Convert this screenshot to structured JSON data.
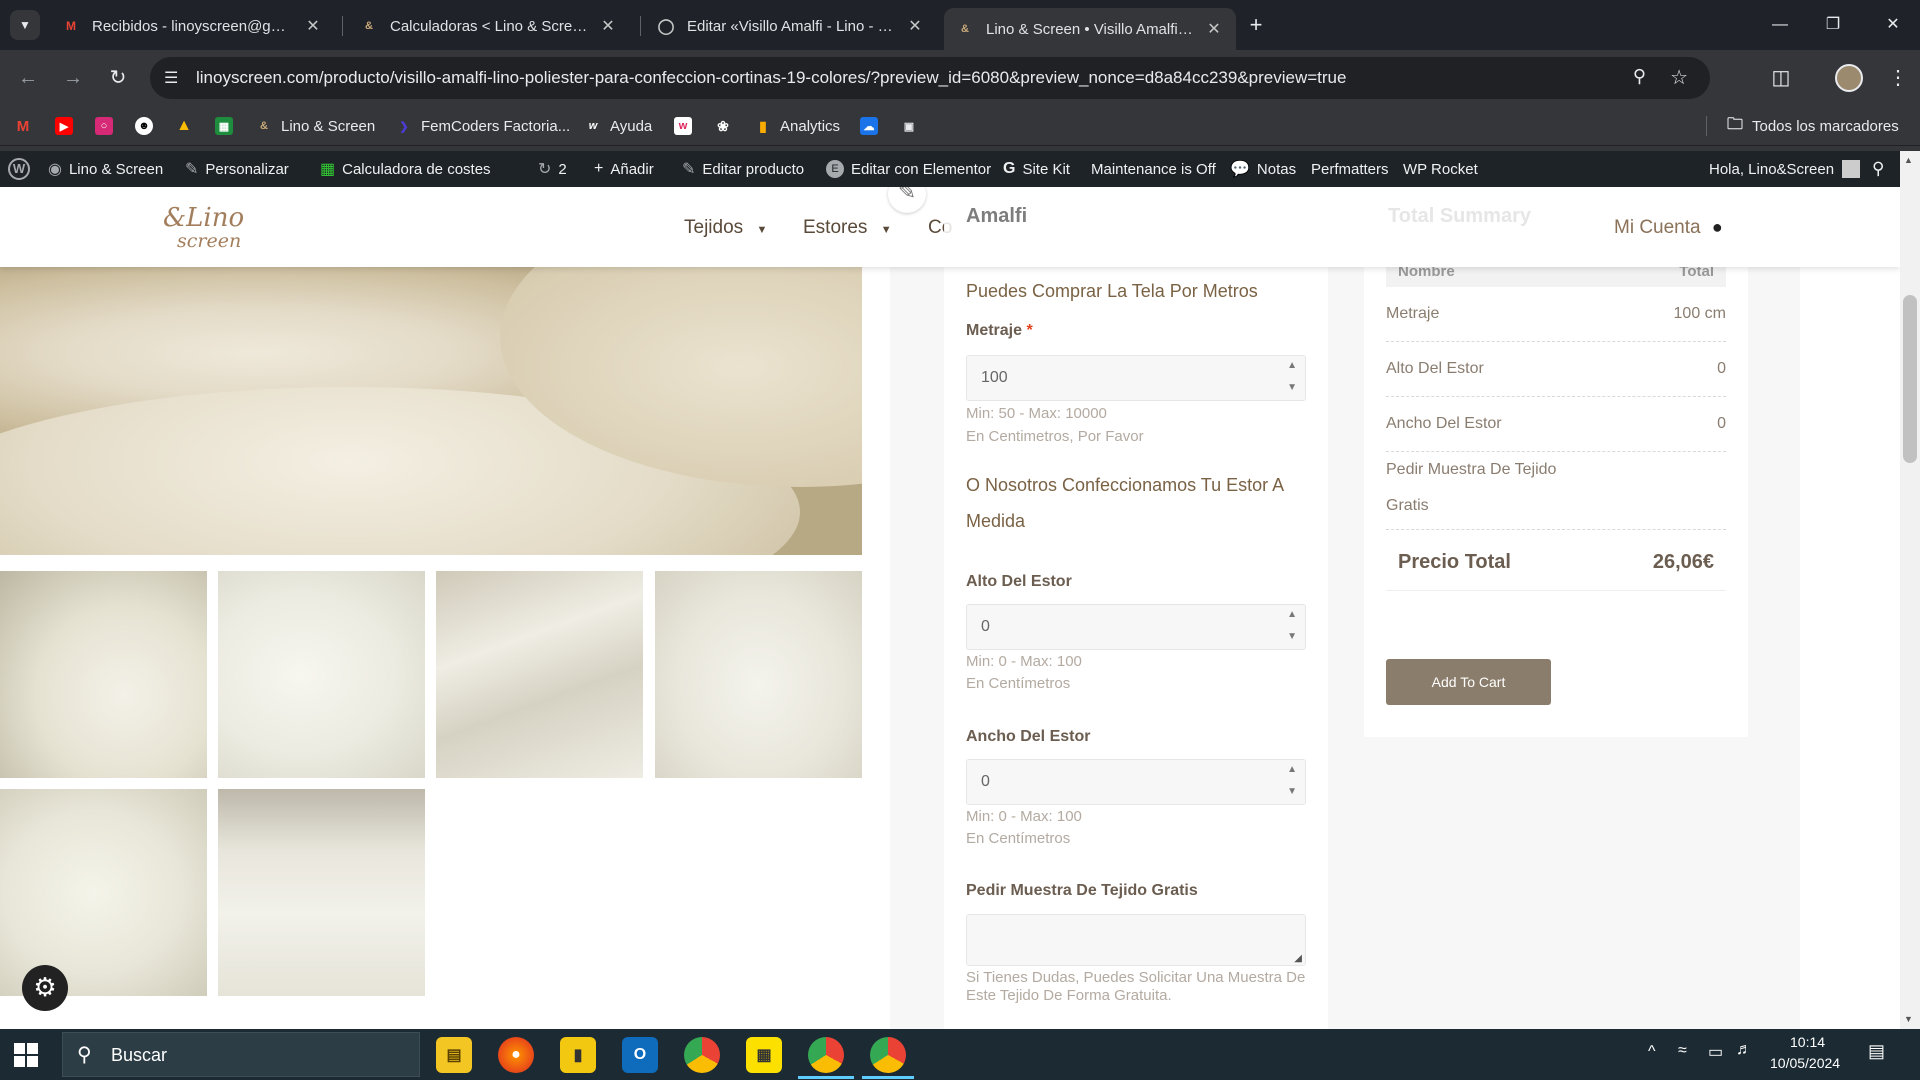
{
  "tabs": [
    {
      "label": "Recibidos - linoyscreen@gmail.",
      "icon": "gmail-icon"
    },
    {
      "label": "Calculadoras < Lino & Screen —",
      "icon": "lino-icon"
    },
    {
      "label": "Editar «Visillo Amalfi - Lino - Poli",
      "icon": "globe-icon"
    },
    {
      "label": "Lino & Screen • Visillo Amalfi - L",
      "icon": "lino-icon"
    }
  ],
  "url": "linoyscreen.com/producto/visillo-amalfi-lino-poliester-para-confeccion-cortinas-19-colores/?preview_id=6080&preview_nonce=d8a84cc239&preview=true",
  "bookmarks": [
    {
      "label": "Lino & Screen"
    },
    {
      "label": "FemCoders Factoria..."
    },
    {
      "label": "Ayuda"
    },
    {
      "label": "Analytics"
    },
    {
      "label": "Todos los marcadores"
    }
  ],
  "wpbar": {
    "site": "Lino & Screen",
    "customize": "Personalizar",
    "calc": "Calculadora de costes",
    "updates": "2",
    "add": "Añadir",
    "edit_product": "Editar producto",
    "elementor": "Editar con Elementor",
    "sitekit": "Site Kit",
    "maintenance": "Maintenance is Off",
    "notes": "Notas",
    "perfmatters": "Perfmatters",
    "wprocket": "WP Rocket",
    "greeting": "Hola, Lino&Screen"
  },
  "site": {
    "logo_top": "&Lino",
    "logo_bottom": "screen",
    "menu": [
      "Tejidos",
      "Estores",
      "Co"
    ],
    "account": "Mi Cuenta"
  },
  "form": {
    "product_name": "Amalfi",
    "section1": "Puedes Comprar La Tela Por Metros",
    "metraje_label": "Metraje",
    "required_mark": "*",
    "metraje_value": "100",
    "metraje_hint1": "Min: 50 - Max: 10000",
    "metraje_hint2": "En Centimetros, Por Favor",
    "section2": "O Nosotros Confeccionamos Tu Estor A Medida",
    "alto_label": "Alto Del Estor",
    "alto_value": "0",
    "alto_hint1": "Min: 0 - Max: 100",
    "alto_hint2": "En Centímetros",
    "ancho_label": "Ancho Del Estor",
    "ancho_value": "0",
    "ancho_hint1": "Min: 0 - Max: 100",
    "ancho_hint2": "En Centímetros",
    "muestra_label": "Pedir Muestra De Tejido Gratis",
    "muestra_hint": "Si Tienes Dudas, Puedes Solicitar Una Muestra De Este Tejido De Forma Gratuita."
  },
  "summary": {
    "title": "Total Summary",
    "col_name": "Nombre",
    "col_total": "Total",
    "rows": [
      {
        "name": "Metraje",
        "value": "100 cm"
      },
      {
        "name": "Alto Del Estor",
        "value": "0"
      },
      {
        "name": "Ancho Del Estor",
        "value": "0"
      },
      {
        "name": "Pedir Muestra De Tejido Gratis",
        "value": ""
      }
    ],
    "total_label": "Precio Total",
    "total_value": "26,06€",
    "add_to_cart": "Add To Cart"
  },
  "taskbar": {
    "search": "Buscar",
    "time": "10:14",
    "date": "10/05/2024"
  }
}
